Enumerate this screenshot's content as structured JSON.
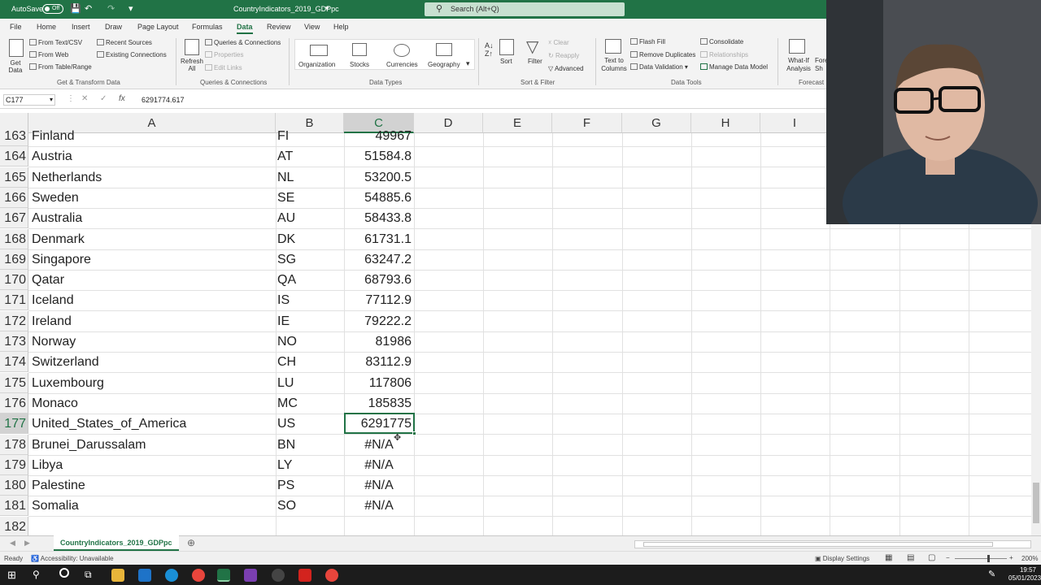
{
  "titlebar": {
    "autosave": "AutoSave",
    "autosave_state": "Off",
    "document_title": "CountryIndicators_2019_GDPpc",
    "search_placeholder": "Search (Alt+Q)"
  },
  "tabs": [
    "File",
    "Home",
    "Insert",
    "Draw",
    "Page Layout",
    "Formulas",
    "Data",
    "Review",
    "View",
    "Help"
  ],
  "active_tab": "Data",
  "ribbon": {
    "get_transform": {
      "get_data": "Get Data",
      "from_text_csv": "From Text/CSV",
      "from_web": "From Web",
      "from_table": "From Table/Range",
      "recent_sources": "Recent Sources",
      "existing_connections": "Existing Connections",
      "group": "Get & Transform Data"
    },
    "queries": {
      "refresh_all": "Refresh All",
      "queries_connections": "Queries & Connections",
      "properties": "Properties",
      "edit_links": "Edit Links",
      "group": "Queries & Connections"
    },
    "data_types": {
      "items": [
        "Organization",
        "Stocks",
        "Currencies",
        "Geography"
      ],
      "group": "Data Types"
    },
    "sort_filter": {
      "sort": "Sort",
      "filter": "Filter",
      "clear": "Clear",
      "reapply": "Reapply",
      "advanced": "Advanced",
      "group": "Sort & Filter"
    },
    "data_tools": {
      "text_to_columns": "Text to Columns",
      "flash_fill": "Flash Fill",
      "remove_duplicates": "Remove Duplicates",
      "data_validation": "Data Validation",
      "consolidate": "Consolidate",
      "relationships": "Relationships",
      "manage_data_model": "Manage Data Model",
      "group": "Data Tools"
    },
    "forecast": {
      "what_if": "What-If Analysis",
      "forecast_sheet": "Fore Sh",
      "group": "Forecast"
    }
  },
  "formula_bar": {
    "name_box": "C177",
    "content": "6291774.617"
  },
  "columns": [
    "A",
    "B",
    "C",
    "D",
    "E",
    "F",
    "G",
    "H",
    "I"
  ],
  "selected_column": "C",
  "rows": [
    {
      "num": "163",
      "a": "Finland",
      "b": "FI",
      "c": "49967"
    },
    {
      "num": "164",
      "a": "Austria",
      "b": "AT",
      "c": "51584.8"
    },
    {
      "num": "165",
      "a": "Netherlands",
      "b": "NL",
      "c": "53200.5"
    },
    {
      "num": "166",
      "a": "Sweden",
      "b": "SE",
      "c": "54885.6"
    },
    {
      "num": "167",
      "a": "Australia",
      "b": "AU",
      "c": "58433.8"
    },
    {
      "num": "168",
      "a": "Denmark",
      "b": "DK",
      "c": "61731.1"
    },
    {
      "num": "169",
      "a": "Singapore",
      "b": "SG",
      "c": "63247.2"
    },
    {
      "num": "170",
      "a": "Qatar",
      "b": "QA",
      "c": "68793.6"
    },
    {
      "num": "171",
      "a": "Iceland",
      "b": "IS",
      "c": "77112.9"
    },
    {
      "num": "172",
      "a": "Ireland",
      "b": "IE",
      "c": "79222.2"
    },
    {
      "num": "173",
      "a": "Norway",
      "b": "NO",
      "c": "81986"
    },
    {
      "num": "174",
      "a": "Switzerland",
      "b": "CH",
      "c": "83112.9"
    },
    {
      "num": "175",
      "a": "Luxembourg",
      "b": "LU",
      "c": "117806"
    },
    {
      "num": "176",
      "a": "Monaco",
      "b": "MC",
      "c": "185835"
    },
    {
      "num": "177",
      "a": "United_States_of_America",
      "b": "US",
      "c": "6291775"
    },
    {
      "num": "178",
      "a": "Brunei_Darussalam",
      "b": "BN",
      "c": "#N/A"
    },
    {
      "num": "179",
      "a": "Libya",
      "b": "LY",
      "c": "#N/A"
    },
    {
      "num": "180",
      "a": "Palestine",
      "b": "PS",
      "c": "#N/A"
    },
    {
      "num": "181",
      "a": "Somalia",
      "b": "SO",
      "c": "#N/A"
    },
    {
      "num": "182",
      "a": "",
      "b": "",
      "c": ""
    }
  ],
  "selected_row": "177",
  "sheet_tab": "CountryIndicators_2019_GDPpc",
  "status": {
    "ready": "Ready",
    "accessibility": "Accessibility: Unavailable",
    "display_settings": "Display Settings",
    "zoom": "200%"
  },
  "clock": {
    "time": "19:57",
    "date": "05/01/2023"
  },
  "colors": {
    "excel_green": "#217346"
  }
}
